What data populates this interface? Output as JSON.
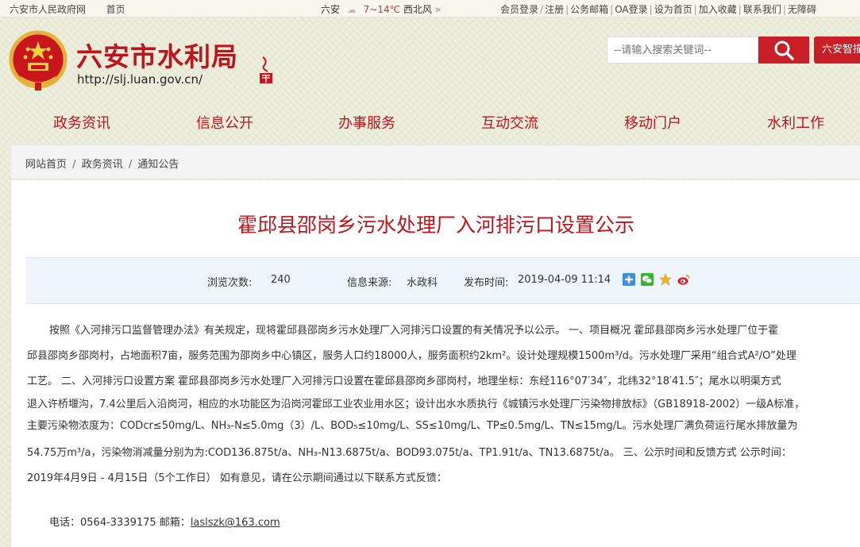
{
  "topbar": {
    "site_name": "六安市人民政府网",
    "home": "首页",
    "weather_city": "六安",
    "weather_temp": "7~14℃",
    "weather_wind": "西北风",
    "weather_arrow": "»",
    "links": [
      "会员登录",
      "注册",
      "公务邮箱",
      "OA登录",
      "设为首页",
      "加入收藏",
      "联系我们",
      "无障碍"
    ]
  },
  "header": {
    "title": "六安市水利局",
    "url": "http://slj.luan.gov.cn/",
    "search_placeholder": "--请输入搜索关键词--",
    "smart_button": "六安智描"
  },
  "nav": {
    "items": [
      "政务资讯",
      "信息公开",
      "办事服务",
      "互动交流",
      "移动门户",
      "水利工作"
    ]
  },
  "breadcrumb": {
    "items": [
      "网站首页",
      "政务资讯",
      "通知公告"
    ],
    "separator": "/"
  },
  "article": {
    "title": "霍邱县邵岗乡污水处理厂入河排污口设置公示",
    "views_label": "浏览次数:",
    "views": "240",
    "source_label": "信息来源:",
    "source": "水政科",
    "time_label": "发布时间:",
    "time": "2019-04-09 11:14",
    "body_lines": [
      "按照《入河排污口监督管理办法》有关规定，现将霍邱县邵岗乡污水处理厂入河排污口设置的有关情况予以公示。    一、项目概况    霍邱县邵岗乡污水处理厂位于霍",
      "邱县邵岗乡邵岗村，占地面积7亩，服务范围为邵岗乡中心镇区，服务人口约18000人，服务面积约2km²。设计处理规模1500m³/d。污水处理厂采用“组合式A²/O”处理",
      "工艺。    二、入河排污口设置方案    霍邱县邵岗乡污水处理厂入河排污口设置在霍邱县邵岗乡邵岗村，地理坐标：东经116°07′34″，北纬32°18′41.5″；尾水以明渠方式",
      "退入许桥堰沟，7.4公里后入沿岗河，相应的水功能区为沿岗河霍邱工业农业用水区；设计出水水质执行《城镇污水处理厂污染物排放标》（GB18918-2002）一级A标准，",
      "主要污染物浓度为：CODcr≤50mg/L、NH₃-N≤5.0mg（3）/L、BOD₅≤10mg/L、SS≤10mg/L、TP≤0.5mg/L、TN≤15mg/L。污水处理厂满负荷运行尾水排放量为",
      "54.75万m³/a，污染物消减量分别为为:COD136.875t/a、NH₃-N13.6875t/a、BOD93.075t/a、TP1.91t/a、TN13.6875t/a。    三、公示时间和反馈方式    公示时间：",
      "2019年4月9日 - 4月15日（5个工作日）    如有意见，请在公示期间通过以下联系方式反馈："
    ],
    "contact_label": "电话：0564-3339175 邮箱：",
    "contact_email": "laslszk@163.com"
  },
  "icons": [
    "emblem-icon",
    "seal-icon",
    "weather-icon",
    "search-icon",
    "share-plus-icon",
    "wechat-icon",
    "qzone-icon",
    "weibo-icon"
  ],
  "colors": {
    "brand_red": "#c0141c",
    "button_red": "#c91e25",
    "meta_bg": "#eef5fa"
  }
}
